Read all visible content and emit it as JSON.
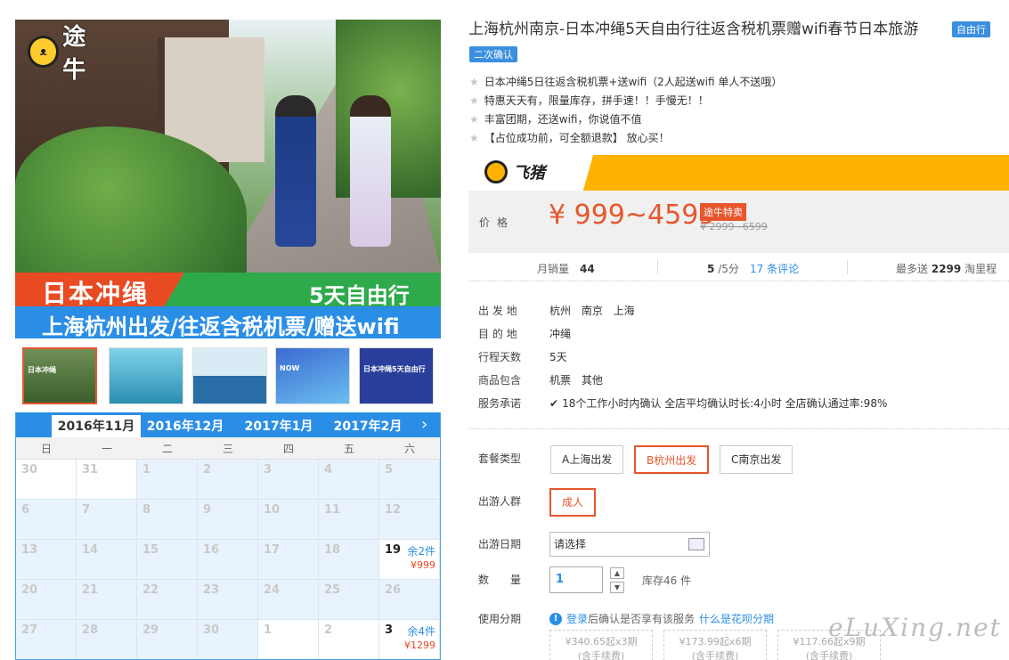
{
  "brand": {
    "logo_text": "途牛"
  },
  "hero": {
    "title": "日本冲绳",
    "days": "5天自由行",
    "subtitle": "上海杭州出发/往返含税机票/赠送wifi"
  },
  "thumbnails": [
    {
      "label": "日本冲绳"
    },
    {
      "label": ""
    },
    {
      "label": ""
    },
    {
      "label": "NOW"
    },
    {
      "label": "日本冲绳5天自由行"
    }
  ],
  "calendar": {
    "months": [
      "2016年11月",
      "2016年12月",
      "2017年1月",
      "2017年2月"
    ],
    "active_month": "2016年11月",
    "weekdays": [
      "日",
      "一",
      "二",
      "三",
      "四",
      "五",
      "六"
    ],
    "rows": [
      [
        {
          "d": "30"
        },
        {
          "d": "31"
        },
        {
          "d": "1"
        },
        {
          "d": "2"
        },
        {
          "d": "3"
        },
        {
          "d": "4"
        },
        {
          "d": "5"
        }
      ],
      [
        {
          "d": "6"
        },
        {
          "d": "7"
        },
        {
          "d": "8"
        },
        {
          "d": "9"
        },
        {
          "d": "10"
        },
        {
          "d": "11"
        },
        {
          "d": "12"
        }
      ],
      [
        {
          "d": "13"
        },
        {
          "d": "14"
        },
        {
          "d": "15"
        },
        {
          "d": "16"
        },
        {
          "d": "17"
        },
        {
          "d": "18"
        },
        {
          "d": "19",
          "stock": "余2件",
          "price": "¥999"
        }
      ],
      [
        {
          "d": "20"
        },
        {
          "d": "21"
        },
        {
          "d": "22"
        },
        {
          "d": "23"
        },
        {
          "d": "24"
        },
        {
          "d": "25"
        },
        {
          "d": "26"
        }
      ],
      [
        {
          "d": "27"
        },
        {
          "d": "28"
        },
        {
          "d": "29"
        },
        {
          "d": "30"
        },
        {
          "d": "1"
        },
        {
          "d": "2"
        },
        {
          "d": "3",
          "stock": "余4件",
          "price": "¥1299"
        }
      ]
    ]
  },
  "product": {
    "title": "上海杭州南京-日本冲绳5天自由行往返含税机票赠wifi春节日本旅游",
    "tag_free": "自由行",
    "tag_confirm": "二次确认",
    "features": [
      "日本冲绳5日往返含税机票+送wifi（2人起送wifi 单人不送哦）",
      "特惠天天有，限量库存，拼手速！！手慢无！！",
      "丰富团期，还送wifi，你说值不值",
      "【占位成功前，可全额退款】 放心买！"
    ]
  },
  "price": {
    "platform": "飞猪",
    "label": "价格",
    "current": "¥ 999~4599",
    "badge": "途牛特卖",
    "original": "¥ 2999~6599"
  },
  "stats": {
    "monthly_label": "月销量",
    "monthly_value": "44",
    "score": "5",
    "score_suffix": "/5分",
    "reviews": "17 条评论",
    "points_prefix": "最多送",
    "points_value": "2299",
    "points_suffix": "淘里程"
  },
  "info": [
    {
      "label": "出 发 地",
      "value": "杭州 南京 上海"
    },
    {
      "label": "目 的 地",
      "value": "冲绳"
    },
    {
      "label": "行程天数",
      "value": "5天"
    },
    {
      "label": "商品包含",
      "value": "机票 其他"
    },
    {
      "label": "服务承诺",
      "value": "18个工作小时内确认   全店平均确认时长:4小时   全店确认通过率:98%"
    }
  ],
  "options": {
    "package_label": "套餐类型",
    "packages": [
      "A上海出发",
      "B杭州出发",
      "C南京出发"
    ],
    "selected_package": "B杭州出发",
    "people_label": "出游人群",
    "people": "成人",
    "date_label": "出游日期",
    "date_placeholder": "请选择",
    "qty_label": "数　　量",
    "qty_value": "1",
    "stock": "库存46 件",
    "bnpl_label": "使用分期",
    "bnpl_login": "登录",
    "bnpl_text": "后确认是否享有该服务",
    "bnpl_link": "什么是花呗分期",
    "installments": [
      {
        "amount": "¥340.65起x3期",
        "fee": "(含手续费)"
      },
      {
        "amount": "¥173.99起x6期",
        "fee": "(含手续费)"
      },
      {
        "amount": "¥117.66起x9期",
        "fee": "(含手续费)"
      }
    ]
  },
  "watermark": "eLuXing.net"
}
